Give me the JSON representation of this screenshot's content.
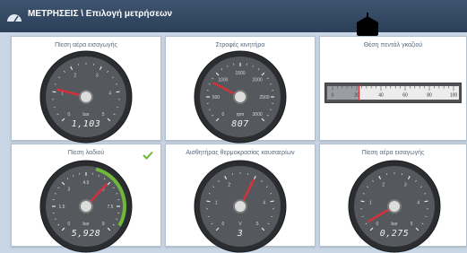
{
  "header": {
    "title": "ΜΕΤΡΗΣΕΙΣ \\ Επιλογή μετρήσεων"
  },
  "panels": [
    {
      "title": "Πίεση αέρα εισαγωγής"
    },
    {
      "title": "Στροφές κινητήρα"
    },
    {
      "title": "Θέση πεντάλ γκαζιού"
    },
    {
      "title": "Πίεση λαδιού"
    },
    {
      "title": "Αισθητήρας θερμοκρασίας καυσαερίων"
    },
    {
      "title": "Πίεση αέρα εισαγωγής"
    }
  ],
  "gauges": [
    {
      "min": 0,
      "max": 5,
      "value": 1.103,
      "ticks": [
        "0",
        "1",
        "2",
        "3",
        "4",
        "5"
      ],
      "unit": "bar",
      "display": "1,103",
      "needle_color": "#d8303a"
    },
    {
      "min": 0,
      "max": 3000,
      "value": 807,
      "ticks": [
        "0",
        "500",
        "1000",
        "1500",
        "2000",
        "2500",
        "3000"
      ],
      "unit": "rpm",
      "display": "807",
      "needle_color": "#d8303a"
    },
    {
      "min": 0,
      "max": 9,
      "value": 5.928,
      "ticks": [
        "0",
        "1.5",
        "3",
        "4.5",
        "6",
        "7.5",
        "9"
      ],
      "unit": "bar",
      "display": "5,928",
      "needle_color": "#d8303a",
      "green_band": [
        5,
        8.5
      ]
    },
    {
      "min": 0,
      "max": 5,
      "value": 3,
      "ticks": [
        "0",
        "1",
        "2",
        "3",
        "4",
        "5"
      ],
      "unit": "V",
      "display": "3",
      "needle_color": "#d8303a"
    },
    {
      "min": 0,
      "max": 5,
      "value": 0.275,
      "ticks": [
        "0",
        "1",
        "2",
        "3",
        "4",
        "5"
      ],
      "unit": "bar",
      "display": "0,275",
      "needle_color": "#d8303a"
    }
  ],
  "pedal": {
    "min": 0,
    "max": 100,
    "value": 22,
    "ticks": [
      "0",
      "20",
      "40",
      "60",
      "80",
      "100"
    ],
    "display": "22",
    "unit": "%"
  },
  "icons": {
    "header": "gauge-icon",
    "cursor": "mouse-cursor-icon",
    "check": "check-icon"
  },
  "colors": {
    "header": "#2f4560",
    "background": "#c9d6e5",
    "accent_green": "#6fb83a",
    "needle": "#d8303a"
  }
}
